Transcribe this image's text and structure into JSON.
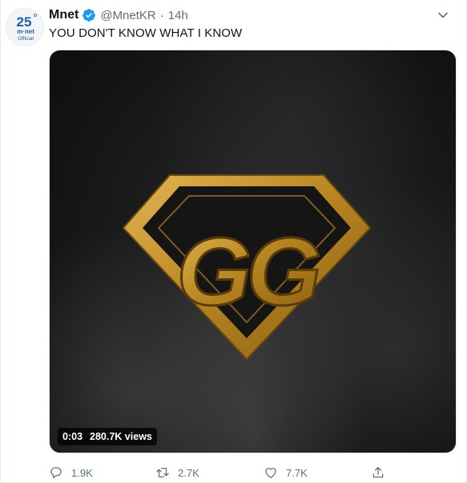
{
  "account": {
    "display_name": "Mnet",
    "handle": "@MnetKR",
    "separator": "·",
    "timestamp": "14h",
    "verified": true,
    "avatar_text": {
      "top": "25",
      "middle": "m·net",
      "bottom": "Official"
    }
  },
  "tweet": {
    "text": "YOU DON'T KNOW WHAT I KNOW"
  },
  "media": {
    "type": "video",
    "logo_text": "GG",
    "elapsed": "0:03",
    "views": "280.7K views"
  },
  "actions": {
    "reply_count": "1.9K",
    "retweet_count": "2.7K",
    "like_count": "7.7K"
  },
  "colors": {
    "brand_blue": "#1d9bf0",
    "muted": "#5b7083",
    "gold": "#c9962b"
  },
  "icons": [
    "verified-badge-icon",
    "chevron-down-icon",
    "reply-icon",
    "retweet-icon",
    "like-icon",
    "share-icon"
  ]
}
